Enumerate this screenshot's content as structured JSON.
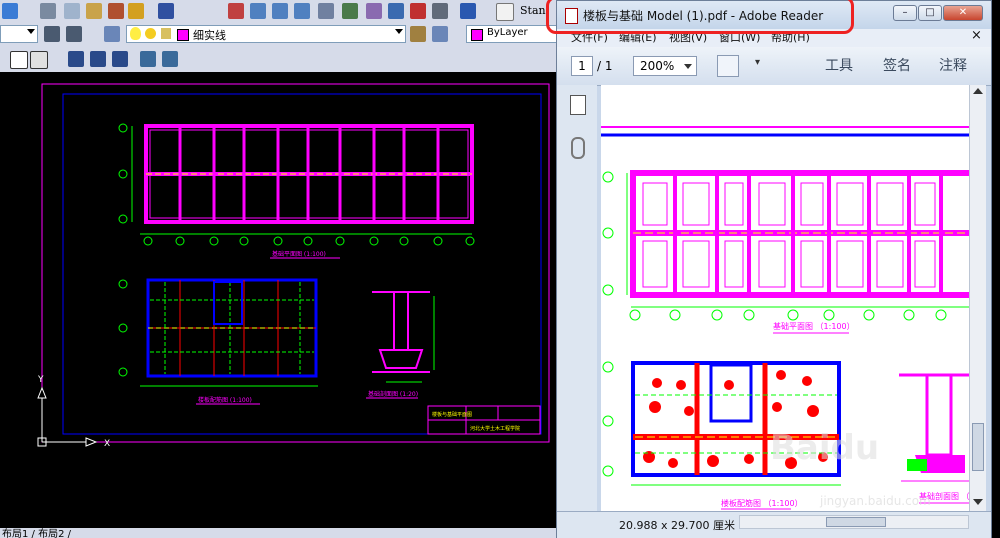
{
  "autocad": {
    "toolbar_row1": {
      "text_style_label": "Stan"
    },
    "toolbar_row2": {
      "layer_name": "细实线",
      "color_name": "ByLayer"
    },
    "status_fragment": "布局1 / 布局2 /",
    "drawing": {
      "plan_caption": "基础平面图 (1:100)",
      "slab_caption": "楼板配筋图 (1:100)",
      "section_caption": "基础剖面图 (1:20)",
      "title_block_name": "楼板与基础平面图",
      "title_block_school": "河北大学土木工程学院",
      "ucs_y": "Y",
      "ucs_x": "X"
    }
  },
  "adobe": {
    "window_title": "楼板与基础 Model (1).pdf - Adobe Reader",
    "window_controls": [
      "–",
      "□",
      "✕"
    ],
    "menu_items": [
      "文件(F)",
      "编辑(E)",
      "视图(V)",
      "窗口(W)",
      "帮助(H)"
    ],
    "menu_close": "×",
    "page_current": "1",
    "page_total": "/ 1",
    "zoom": "200%",
    "tool_buttons": [
      "工具",
      "签名",
      "注释"
    ],
    "page_size_status": "20.988 x 29.700 厘米",
    "pdf_content": {
      "plan_caption": "基础平面图 （1:100）",
      "slab_caption": "楼板配筋图 （1:100）",
      "section_caption": "基础剖面图 （1:20"
    }
  },
  "colors": {
    "cad_bg": "#000000",
    "magenta": "#ff00ff",
    "blue": "#0000ff",
    "green": "#00ff00",
    "red": "#ff0000",
    "yellow": "#ffff00",
    "highlight_red": "#ee2222"
  },
  "watermark": {
    "brand": "Baidu",
    "sub": "jingyan.baidu.com"
  }
}
